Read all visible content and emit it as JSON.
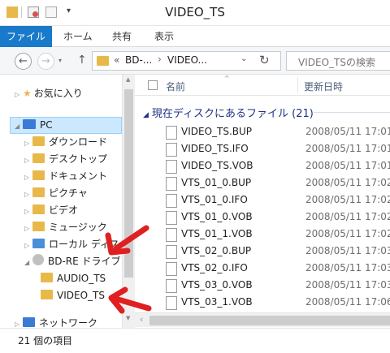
{
  "window": {
    "title": "VIDEO_TS"
  },
  "ribbon": {
    "tabs": [
      "ファイル",
      "ホーム",
      "共有",
      "表示"
    ]
  },
  "address": {
    "back_icon": "back-arrow-icon",
    "forward_icon": "forward-arrow-icon",
    "up_icon": "up-arrow-icon",
    "prefix": "«",
    "crumb1": "BD-...",
    "separator": "›",
    "crumb2": "VIDEO...",
    "search_placeholder": "VIDEO_TSの検索"
  },
  "nav": {
    "favorites": "お気に入り",
    "pc": "PC",
    "items": [
      "ダウンロード",
      "デスクトップ",
      "ドキュメント",
      "ピクチャ",
      "ビデオ",
      "ミュージック",
      "ローカル ディス",
      "BD-RE ドライブ (D",
      "AUDIO_TS",
      "VIDEO_TS",
      "ネットワーク"
    ]
  },
  "columns": {
    "name": "名前",
    "date": "更新日時"
  },
  "group": {
    "label": "現在ディスクにあるファイル (21)"
  },
  "files": [
    {
      "name": "VIDEO_TS.BUP",
      "date": "2008/05/11 17:01"
    },
    {
      "name": "VIDEO_TS.IFO",
      "date": "2008/05/11 17:01"
    },
    {
      "name": "VIDEO_TS.VOB",
      "date": "2008/05/11 17:01"
    },
    {
      "name": "VTS_01_0.BUP",
      "date": "2008/05/11 17:02"
    },
    {
      "name": "VTS_01_0.IFO",
      "date": "2008/05/11 17:02"
    },
    {
      "name": "VTS_01_0.VOB",
      "date": "2008/05/11 17:02"
    },
    {
      "name": "VTS_01_1.VOB",
      "date": "2008/05/11 17:02"
    },
    {
      "name": "VTS_02_0.BUP",
      "date": "2008/05/11 17:03"
    },
    {
      "name": "VTS_02_0.IFO",
      "date": "2008/05/11 17:03"
    },
    {
      "name": "VTS_03_0.VOB",
      "date": "2008/05/11 17:03"
    },
    {
      "name": "VTS_03_1.VOB",
      "date": "2008/05/11 17:06"
    }
  ],
  "status": {
    "count": "21 個の項目"
  },
  "colors": {
    "accent": "#1979ca",
    "folder": "#e8b94a",
    "arrow": "#e02020"
  }
}
